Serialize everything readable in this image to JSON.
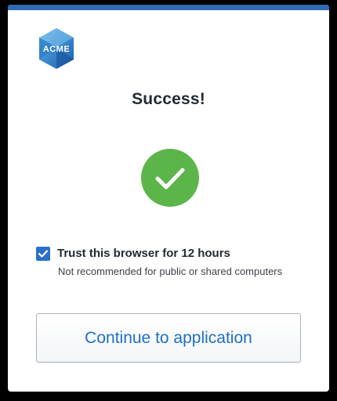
{
  "brand": {
    "logo_text": "ACME",
    "accent_color": "#2e6bb4"
  },
  "status": {
    "title": "Success!",
    "icon": "check-circle-icon",
    "success_color": "#5cb548"
  },
  "trust": {
    "checked": true,
    "label": "Trust this browser for 12 hours",
    "sublabel": "Not recommended for public or shared computers"
  },
  "actions": {
    "continue_label": "Continue to application"
  }
}
